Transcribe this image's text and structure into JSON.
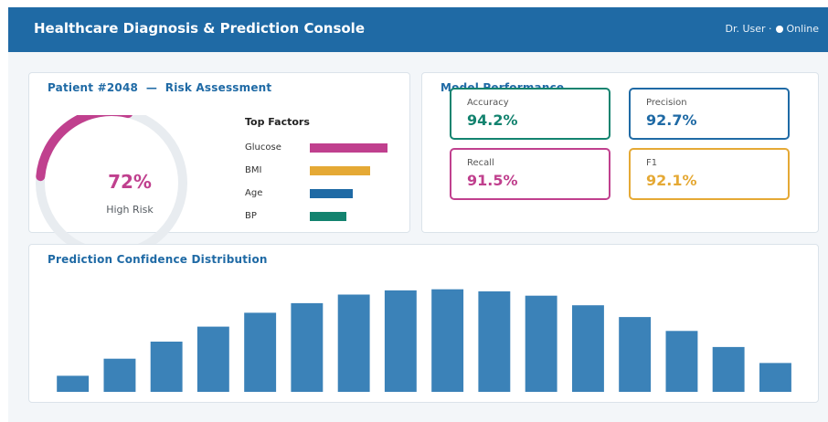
{
  "header": {
    "title": "Healthcare Diagnosis & Prediction Console",
    "user": "Dr. User ·",
    "status": "Online"
  },
  "patient": {
    "title": "Patient #2048  —  Risk Assessment",
    "risk_value": "72%",
    "risk_fraction": 0.72,
    "risk_label": "High Risk",
    "accent_color": "#c0408e",
    "factors_heading": "Top Factors",
    "factors": [
      {
        "label": "Glucose",
        "weight": 0.85,
        "color": "#c0408e"
      },
      {
        "label": "BMI",
        "weight": 0.66,
        "color": "#e5a935"
      },
      {
        "label": "Age",
        "weight": 0.47,
        "color": "#1f6aa5"
      },
      {
        "label": "BP",
        "weight": 0.4,
        "color": "#13836f"
      }
    ]
  },
  "model": {
    "title": "Model Performance",
    "metrics": [
      {
        "label": "Accuracy",
        "value": "94.2%",
        "color": "#13836f"
      },
      {
        "label": "Precision",
        "value": "92.7%",
        "color": "#1f6aa5"
      },
      {
        "label": "Recall",
        "value": "91.5%",
        "color": "#c0408e"
      },
      {
        "label": "F1",
        "value": "92.1%",
        "color": "#e5a935"
      }
    ]
  },
  "distribution": {
    "title": "Prediction Confidence Distribution"
  },
  "chart_data": {
    "type": "bar",
    "title": "Prediction Confidence Distribution",
    "values": [
      15,
      31,
      47,
      61,
      74,
      83,
      91,
      95,
      96,
      94,
      90,
      81,
      70,
      57,
      42,
      27
    ],
    "ylim": [
      0,
      100
    ],
    "grid": false,
    "bar_color": "#3b82b8"
  }
}
